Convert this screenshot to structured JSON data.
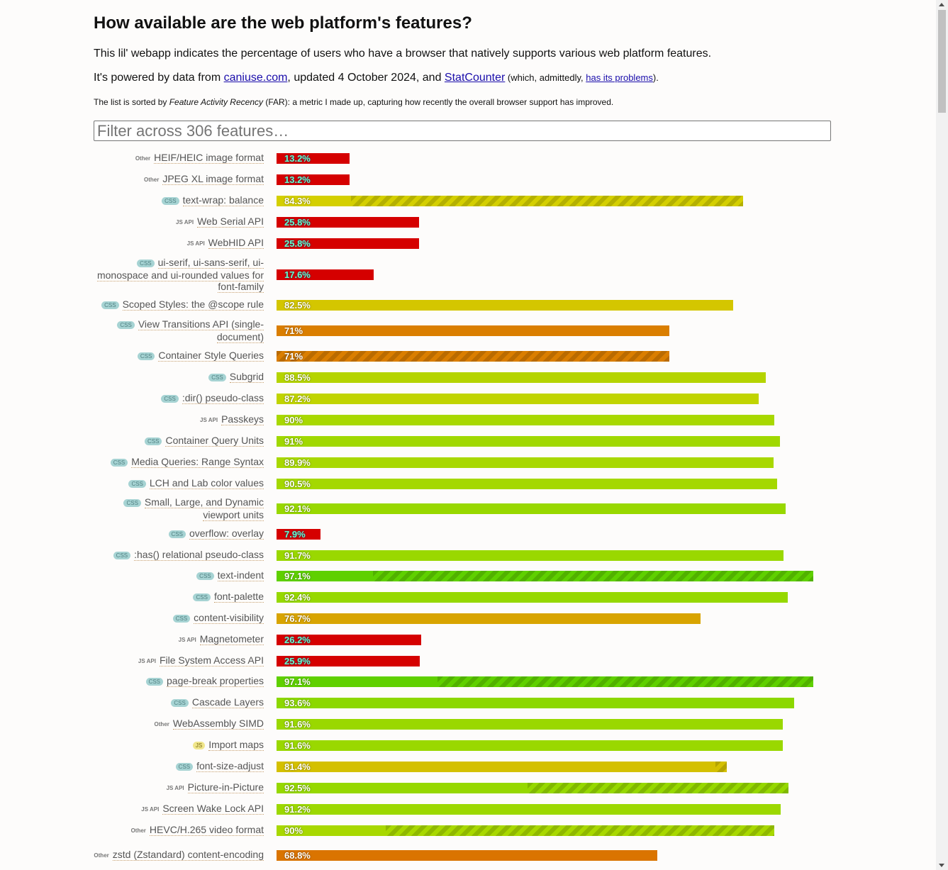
{
  "header": {
    "title": "How available are the web platform's features?",
    "intro": "This lil' webapp indicates the percentage of users who have a browser that natively supports various web platform features.",
    "powered_prefix": "It's powered by data from ",
    "caniuse_link": "caniuse.com",
    "powered_mid": ", updated 4 October 2024, and ",
    "statcounter_link": "StatCounter",
    "small_prefix": " (which, admittedly, ",
    "problems_link": "has its problems",
    "small_suffix": ").",
    "sort_prefix": "The list is sorted by ",
    "sort_em": "Feature Activity Recency",
    "sort_suffix": " (FAR): a metric I made up, capturing how recently the overall browser support has improved."
  },
  "filter": {
    "placeholder": "Filter across 306 features…"
  },
  "features": [
    {
      "category": "Other",
      "name": "HEIF/HEIC image format",
      "pct": 13.2,
      "label": "13.2%",
      "color": "#d50000"
    },
    {
      "category": "Other",
      "name": "JPEG XL image format",
      "pct": 13.2,
      "label": "13.2%",
      "color": "#d50000"
    },
    {
      "category": "CSS",
      "name": "text-wrap: balance",
      "pct": 84.3,
      "label": "84.3%",
      "color": "#d4cf00",
      "partial": 0.84
    },
    {
      "category": "JS API",
      "name": "Web Serial API",
      "pct": 25.8,
      "label": "25.8%",
      "color": "#d50000"
    },
    {
      "category": "JS API",
      "name": "WebHID API",
      "pct": 25.8,
      "label": "25.8%",
      "color": "#d50000"
    },
    {
      "category": "CSS",
      "name": "ui-serif, ui-sans-serif, ui-monospace and ui-rounded values for font-family",
      "pct": 17.6,
      "label": "17.6%",
      "color": "#d50000"
    },
    {
      "category": "CSS",
      "name": "Scoped Styles: the @scope rule",
      "pct": 82.5,
      "label": "82.5%",
      "color": "#d4c600"
    },
    {
      "category": "CSS",
      "name": "View Transitions API (single-document)",
      "pct": 71,
      "label": "71%",
      "color": "#da7e00"
    },
    {
      "category": "CSS",
      "name": "Container Style Queries",
      "pct": 71,
      "label": "71%",
      "color": "#da7e00",
      "partial": 1.0
    },
    {
      "category": "CSS",
      "name": "Subgrid",
      "pct": 88.5,
      "label": "88.5%",
      "color": "#b5d400"
    },
    {
      "category": "CSS",
      "name": ":dir() pseudo-class",
      "pct": 87.2,
      "label": "87.2%",
      "color": "#c0d400"
    },
    {
      "category": "JS API",
      "name": "Passkeys",
      "pct": 90,
      "label": "90%",
      "color": "#a8d800"
    },
    {
      "category": "CSS",
      "name": "Container Query Units",
      "pct": 91,
      "label": "91%",
      "color": "#a0d800"
    },
    {
      "category": "CSS",
      "name": "Media Queries: Range Syntax",
      "pct": 89.9,
      "label": "89.9%",
      "color": "#a8d800"
    },
    {
      "category": "CSS",
      "name": "LCH and Lab color values",
      "pct": 90.5,
      "label": "90.5%",
      "color": "#a4d800"
    },
    {
      "category": "CSS",
      "name": "Small, Large, and Dynamic viewport units",
      "pct": 92.1,
      "label": "92.1%",
      "color": "#98d800"
    },
    {
      "category": "CSS",
      "name": "overflow: overlay",
      "pct": 7.9,
      "label": "7.9%",
      "color": "#d50000"
    },
    {
      "category": "CSS",
      "name": ":has() relational pseudo-class",
      "pct": 91.7,
      "label": "91.7%",
      "color": "#9ad800"
    },
    {
      "category": "CSS",
      "name": "text-indent",
      "pct": 97.1,
      "label": "97.1%",
      "color": "#5fd000",
      "partial": 0.82
    },
    {
      "category": "CSS",
      "name": "font-palette",
      "pct": 92.4,
      "label": "92.4%",
      "color": "#96d800"
    },
    {
      "category": "CSS",
      "name": "content-visibility",
      "pct": 76.7,
      "label": "76.7%",
      "color": "#d8a400"
    },
    {
      "category": "JS API",
      "name": "Magnetometer",
      "pct": 26.2,
      "label": "26.2%",
      "color": "#d50000"
    },
    {
      "category": "JS API",
      "name": "File System Access API",
      "pct": 25.9,
      "label": "25.9%",
      "color": "#d50000"
    },
    {
      "category": "CSS",
      "name": "page-break properties",
      "pct": 97.1,
      "label": "97.1%",
      "color": "#5fd000",
      "partial": 0.7
    },
    {
      "category": "CSS",
      "name": "Cascade Layers",
      "pct": 93.6,
      "label": "93.6%",
      "color": "#8cd800"
    },
    {
      "category": "Other",
      "name": "WebAssembly SIMD",
      "pct": 91.6,
      "label": "91.6%",
      "color": "#9ad800"
    },
    {
      "category": "JS",
      "name": "Import maps",
      "pct": 91.6,
      "label": "91.6%",
      "color": "#9ad800"
    },
    {
      "category": "CSS",
      "name": "font-size-adjust",
      "pct": 81.4,
      "label": "81.4%",
      "color": "#d4c000",
      "partial": 0.025
    },
    {
      "category": "JS API",
      "name": "Picture-in-Picture",
      "pct": 92.5,
      "label": "92.5%",
      "color": "#96d800",
      "partial": 0.51
    },
    {
      "category": "JS API",
      "name": "Screen Wake Lock API",
      "pct": 91.2,
      "label": "91.2%",
      "color": "#9cd800"
    },
    {
      "category": "Other",
      "name": "HEVC/H.265 video format",
      "pct": 90,
      "label": "90%",
      "color": "#a8d800",
      "partial": 0.78
    },
    {
      "category": "Other",
      "name": "zstd (Zstandard) content-encoding",
      "pct": 68.8,
      "label": "68.8%",
      "color": "#da7400"
    }
  ]
}
